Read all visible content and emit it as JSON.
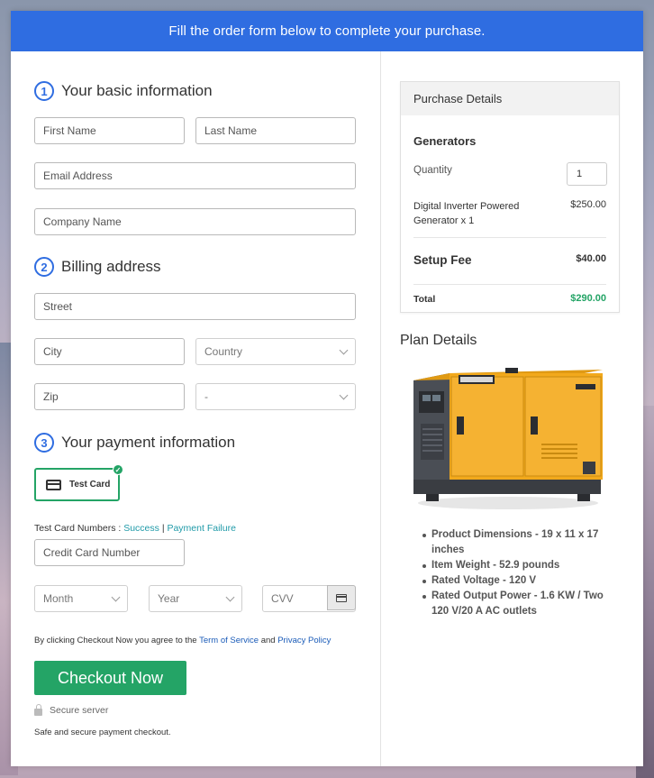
{
  "banner": {
    "text": "Fill the order form below to complete your purchase."
  },
  "basic": {
    "number": "1",
    "title": "Your basic information",
    "first_name": "First Name",
    "last_name": "Last Name",
    "email": "Email Address",
    "company": "Company Name"
  },
  "billing": {
    "number": "2",
    "title": "Billing address",
    "street": "Street",
    "city": "City",
    "country": "Country",
    "zip": "Zip",
    "state": "-"
  },
  "payment": {
    "number": "3",
    "title": "Your payment information",
    "test_card_label": "Test Card",
    "test_numbers_prefix": "Test Card Numbers :",
    "success_link": "Success",
    "separator": "|",
    "failure_link": "Payment Failure",
    "card_number": "Credit Card Number",
    "month": "Month",
    "year": "Year",
    "cvv": "CVV"
  },
  "agreement": {
    "prefix": "By clicking Checkout Now you agree to the",
    "tos": "Term of Service",
    "and": "and",
    "privacy": "Privacy Policy"
  },
  "checkout": {
    "button": "Checkout Now",
    "secure": "Secure server",
    "safe": "Safe and secure payment checkout."
  },
  "purchase": {
    "header": "Purchase Details",
    "category": "Generators",
    "quantity_label": "Quantity",
    "quantity_value": "1",
    "item_name": "Digital Inverter Powered Generator x 1",
    "item_price": "$250.00",
    "setup_label": "Setup Fee",
    "setup_price": "$40.00",
    "total_label": "Total",
    "total_price": "$290.00"
  },
  "plan": {
    "title": "Plan Details",
    "features": [
      "Product Dimensions - 19 x 11 x 17 inches",
      "Item Weight - 52.9 pounds",
      "Rated Voltage - 120 V",
      "Rated Output Power - 1.6 KW / Two 120 V/20 A AC outlets"
    ]
  },
  "colors": {
    "banner": "#2f6de1",
    "accent_green": "#24a466",
    "link_teal": "#1f9aa8",
    "link_blue": "#1a5bb8",
    "generator_yellow": "#f2a91c"
  }
}
